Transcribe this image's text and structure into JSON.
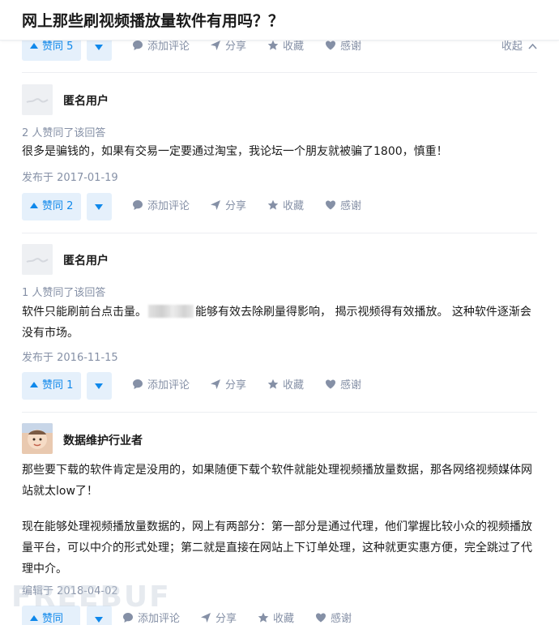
{
  "question": {
    "title": "网上那些刷视频播放量软件有用吗？？"
  },
  "labels": {
    "comment": "添加评论",
    "share": "分享",
    "favorite": "收藏",
    "thanks": "感谢",
    "collapse": "收起"
  },
  "answers": [
    {
      "vote_label": "赞同 5"
    },
    {
      "author": "匿名用户",
      "votes": "2 人赞同了该回答",
      "body": "很多是骗钱的，如果有交易一定要通过淘宝，我论坛一个朋友就被骗了1800，慎重！",
      "date": "发布于 2017-01-19",
      "vote_label": "赞同 2"
    },
    {
      "author": "匿名用户",
      "votes": "1 人赞同了该回答",
      "body_a": "软件只能刷前台点击量。",
      "body_b": "能够有效去除刷量得影响， 揭示视频得有效播放。 这种软件逐渐会没有市场。",
      "date": "发布于 2016-11-15",
      "vote_label": "赞同 1"
    },
    {
      "author": "数据维护行业者",
      "body_p1": "那些要下载的软件肯定是没用的，如果随便下载个软件就能处理视频播放量数据，那各网络视频媒体网站就太low了！",
      "body_p2": "现在能够处理视频播放量数据的，网上有两部分：第一部分是通过代理，他们掌握比较小众的视频播放量平台，可以中介的形式处理；第二就是直接在网站上下订单处理，这种就更实惠方便，完全跳过了代理中介。",
      "date": "编辑于 2018-04-02",
      "vote_label": "赞同"
    }
  ],
  "watermark": "FREEBUF",
  "colors": {
    "accent": "#0f88eb",
    "muted": "#8590a6",
    "vote_bg": "#e5f0fb",
    "divider": "#eceef2"
  }
}
